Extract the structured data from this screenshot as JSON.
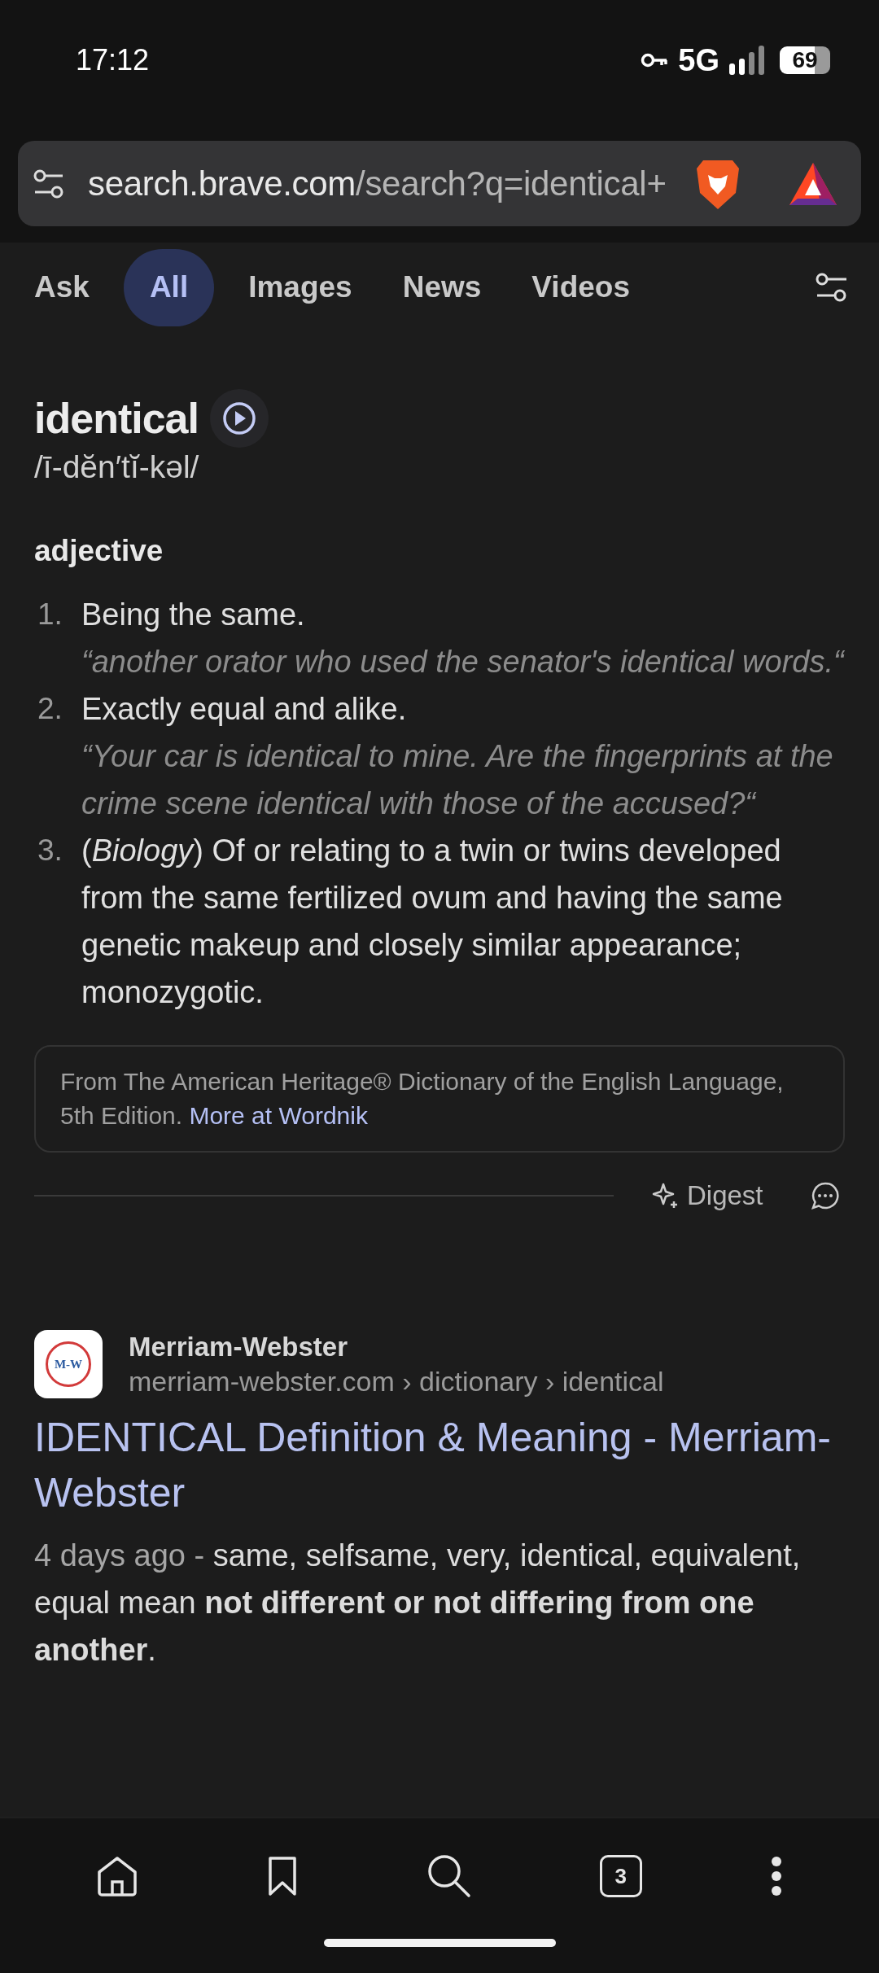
{
  "status_bar": {
    "time": "17:12",
    "network": "5G",
    "battery": "69"
  },
  "address_bar": {
    "host": "search.brave.com",
    "path": "/search?q=identical+"
  },
  "tabs": [
    {
      "label": "Ask",
      "selected": false
    },
    {
      "label": "All",
      "selected": true
    },
    {
      "label": "Images",
      "selected": false
    },
    {
      "label": "News",
      "selected": false
    },
    {
      "label": "Videos",
      "selected": false
    }
  ],
  "definition": {
    "word": "identical",
    "pronunciation": "/ī-dĕn′tĭ-kəl/",
    "part_of_speech": "adjective",
    "senses": [
      {
        "number": "1.",
        "text": "Being the same.",
        "example": "“another orator who used the senator's identical words.“"
      },
      {
        "number": "2.",
        "text": "Exactly equal and alike.",
        "example": "“Your car is identical to mine. Are the fingerprints at the crime scene identical with those of the accused?“"
      },
      {
        "number": "3.",
        "text": "(*Biology*) Of or relating to a twin or twins developed from the same fertilized ovum and having the same genetic makeup and closely similar appearance; monozygotic."
      }
    ],
    "source": {
      "text": "From The American Heritage® Dictionary of the English Language, 5th Edition.",
      "link": "More at Wordnik"
    },
    "digest_label": "Digest"
  },
  "result": {
    "favicon_text": "M-W",
    "site_name": "Merriam-Webster",
    "breadcrumb": "merriam-webster.com › dictionary › identical",
    "title": "IDENTICAL Definition & Meaning - Merriam-Webster",
    "date": "4 days ago - ",
    "snippet": "same, selfsame, very, identical, equivalent, equal mean **not different or not differing from one another**."
  },
  "bottom_nav": {
    "tab_count": "3"
  }
}
